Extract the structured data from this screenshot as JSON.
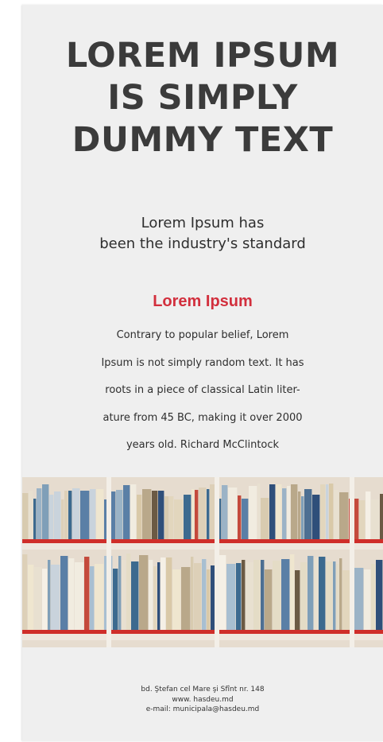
{
  "headline": {
    "line1": "LOREM IPSUM",
    "line2": "IS SIMPLY",
    "line3": "DUMMY TEXT"
  },
  "subheading": {
    "line1": "Lorem Ipsum has",
    "line2": "been the industry's standard"
  },
  "section": {
    "title": "Lorem Ipsum",
    "color": "#d22f3d",
    "paragraph": [
      "Contrary to popular belief, Lorem",
      "Ipsum is not simply random text. It has",
      "roots in a piece of classical Latin liter-",
      "ature from 45 BC, making it over 2000",
      "years old. Richard McClintock"
    ]
  },
  "footer": {
    "address": "bd. Ştefan cel Mare şi Sfînt nr. 148",
    "website": "www. hasdeu.md",
    "email": "e-mail: municipala@hasdeu.md"
  }
}
